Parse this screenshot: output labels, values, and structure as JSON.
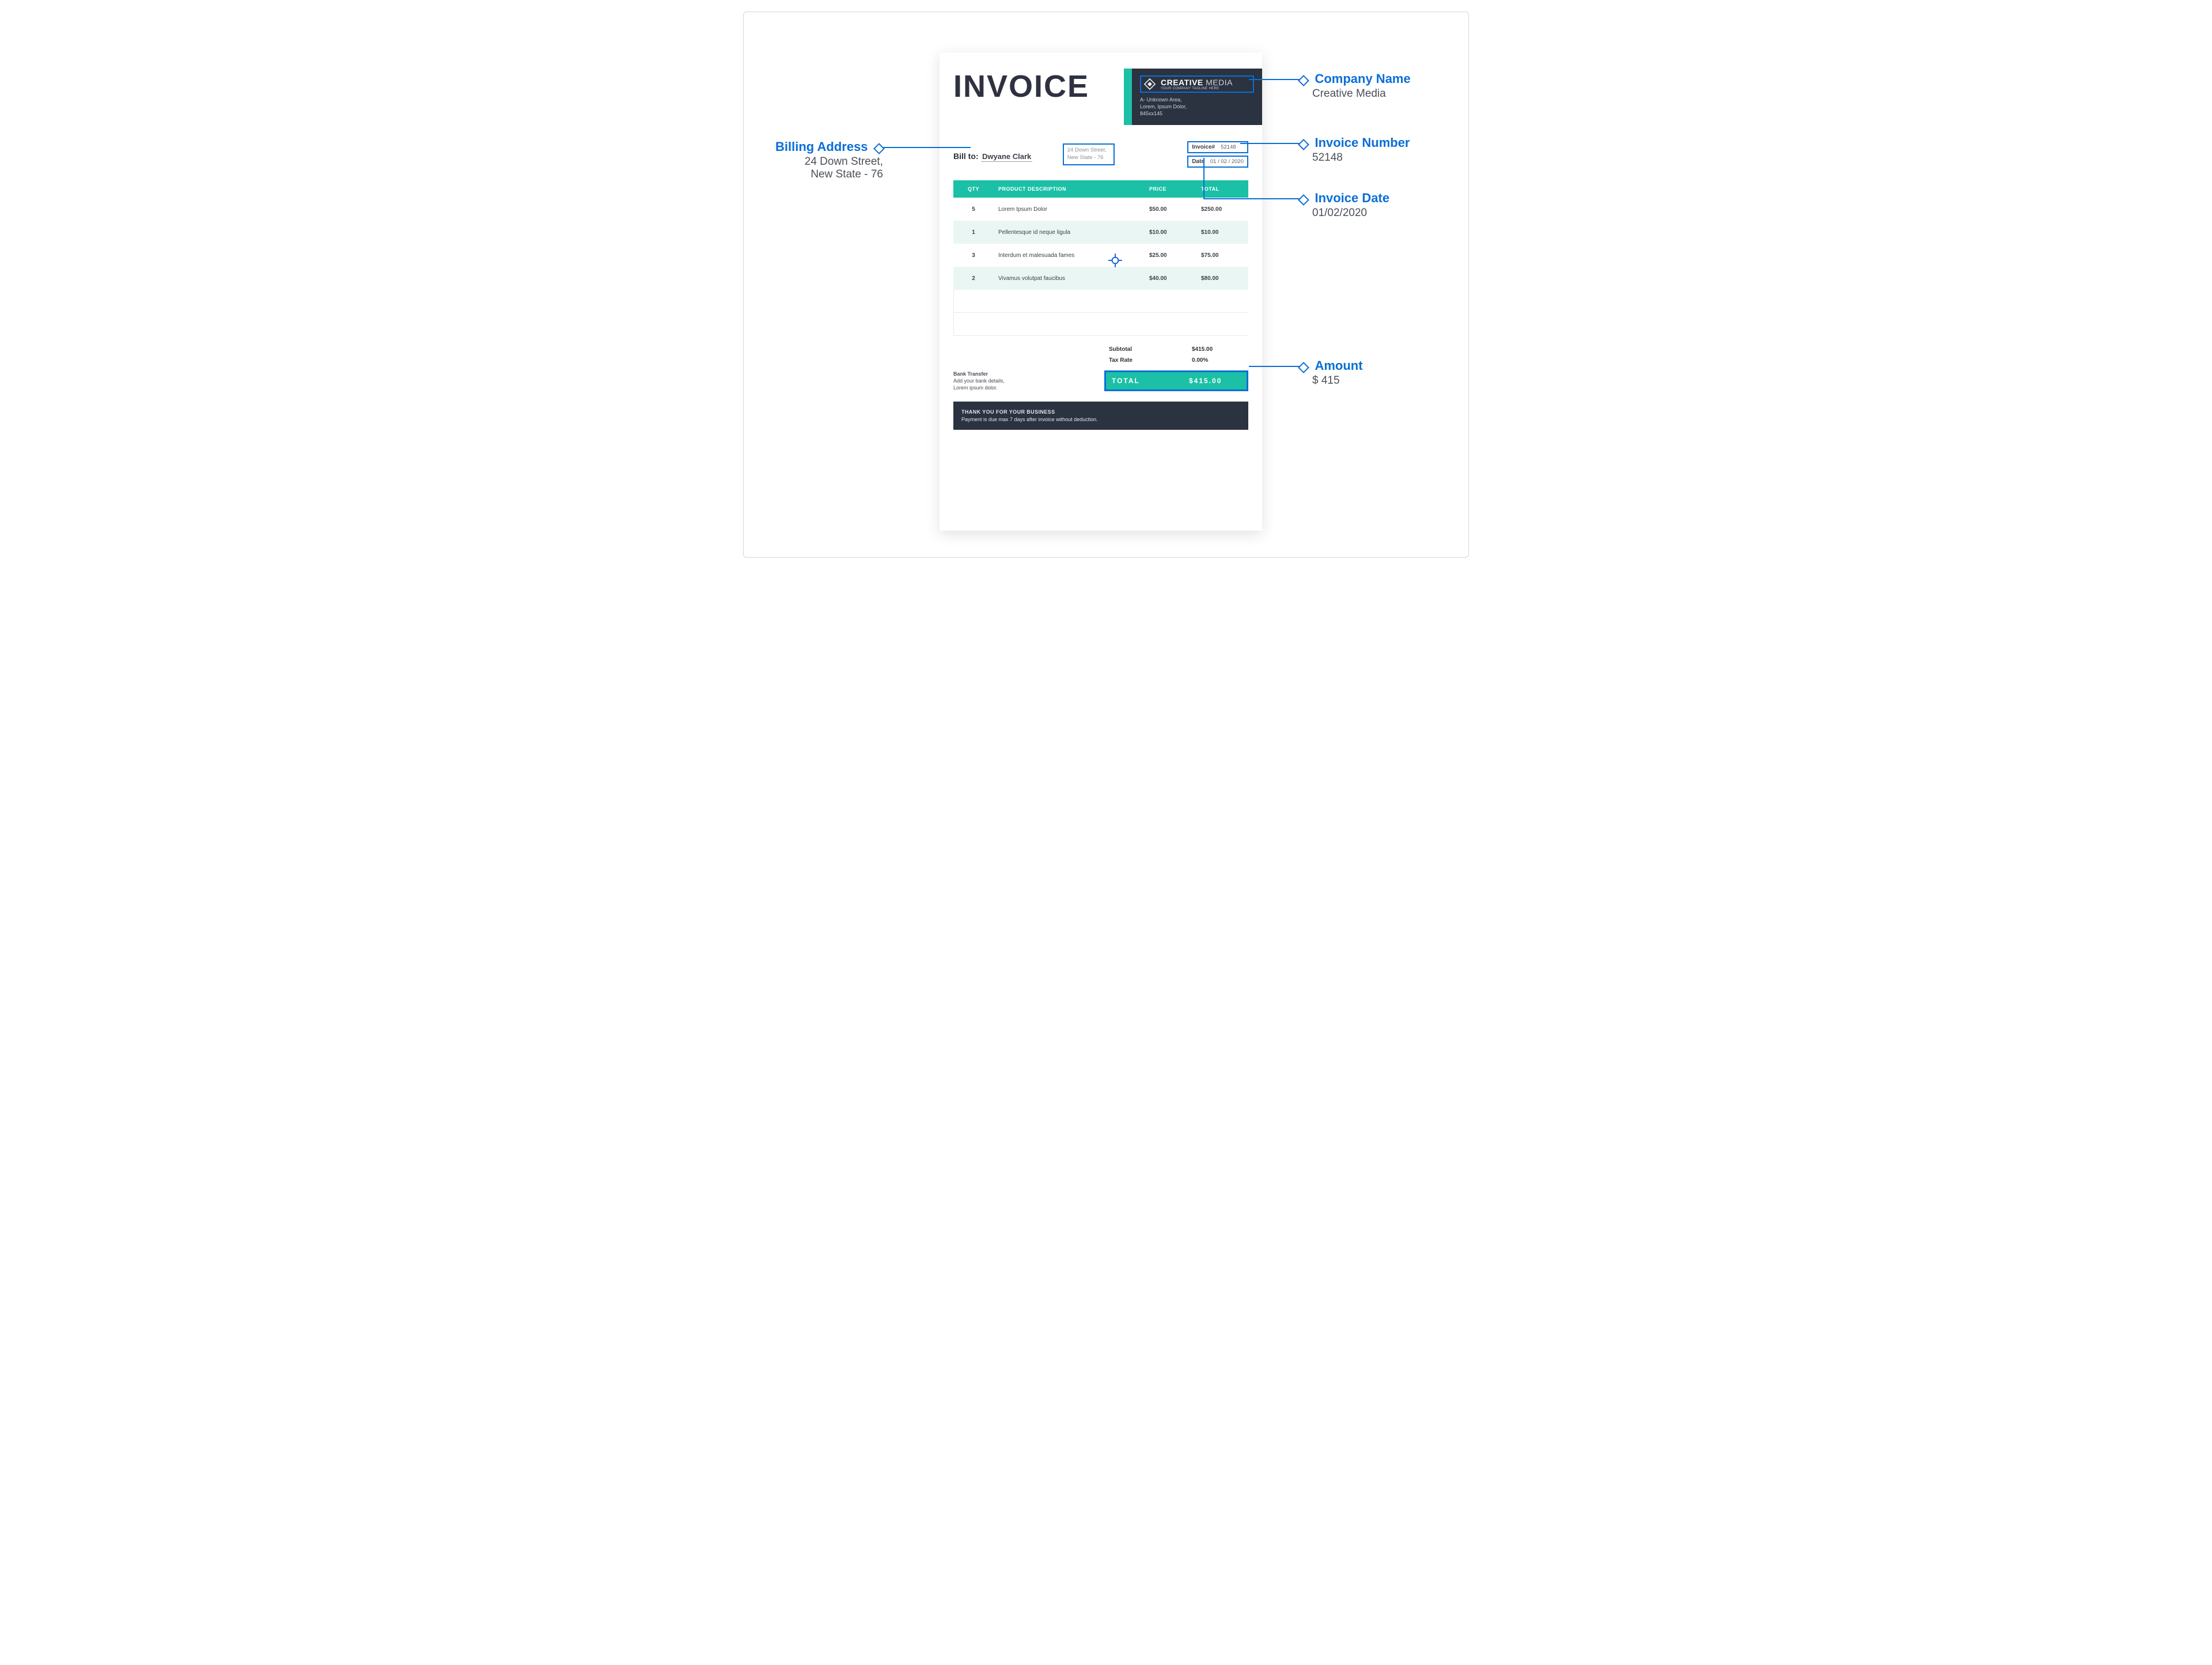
{
  "invoice": {
    "title": "INVOICE",
    "brand": {
      "name_strong": "CREATIVE",
      "name_light": "MEDIA",
      "tagline": "YOUR COMPANY TAGLINE HERE",
      "address": "A- Unknown Area,\nLorem, Ipsum Dolor,\n845xx145"
    },
    "bill_to_label": "Bill to:",
    "bill_to_name": "Dwyane Clark",
    "bill_to_address": "24 Down Street,\nNew State - 76",
    "meta": {
      "invoice_no_label": "Invoice#",
      "invoice_no": "52148",
      "date_label": "Date",
      "date": "01 / 02 / 2020"
    },
    "columns": {
      "qty": "QTY",
      "desc": "PRODUCT DESCRIPTION",
      "price": "PRICE",
      "total": "TOTAL"
    },
    "rows": [
      {
        "qty": "5",
        "desc": "Lorem Ipsum Dolor",
        "price": "$50.00",
        "total": "$250.00"
      },
      {
        "qty": "1",
        "desc": "Pellentesque id neque ligula",
        "price": "$10.00",
        "total": "$10.00"
      },
      {
        "qty": "3",
        "desc": "Interdum et malesuada fames",
        "price": "$25.00",
        "total": "$75.00"
      },
      {
        "qty": "2",
        "desc": "Vivamus volutpat faucibus",
        "price": "$40.00",
        "total": "$80.00"
      }
    ],
    "bank": {
      "title": "Bank Transfer",
      "line1": "Add your bank details,",
      "line2": "Lorem ipsum dolor."
    },
    "summary": {
      "subtotal_label": "Subtotal",
      "subtotal": "$415.00",
      "tax_label": "Tax Rate",
      "tax": "0.00%",
      "total_label": "TOTAL",
      "total": "$415.00"
    },
    "footer": {
      "line1": "THANK YOU FOR YOUR BUSINESS",
      "line2": "Payment is due max 7 days after invoice without deduction."
    }
  },
  "callouts": {
    "company_name": {
      "title": "Company Name",
      "value": "Creative Media"
    },
    "invoice_number": {
      "title": "Invoice Number",
      "value": "52148"
    },
    "invoice_date": {
      "title": "Invoice Date",
      "value": "01/02/2020"
    },
    "amount": {
      "title": "Amount",
      "value": "$ 415"
    },
    "billing_address": {
      "title": "Billing Address",
      "value": "24 Down Street,\nNew State - 76"
    }
  }
}
